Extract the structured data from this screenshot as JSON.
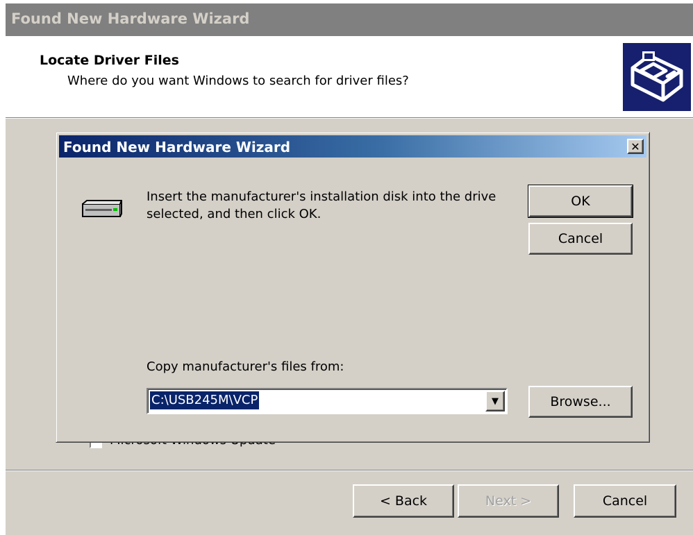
{
  "background_wizard": {
    "title": "Found New Hardware Wizard",
    "header": {
      "title": "Locate Driver Files",
      "subtitle": "Where do you want Windows to search for driver files?"
    },
    "checkbox_label": "Microsoft Windows Update",
    "buttons": {
      "back": "< Back",
      "next": "Next >",
      "cancel": "Cancel"
    }
  },
  "dialog": {
    "title": "Found New Hardware Wizard",
    "close_glyph": "✕",
    "message": "Insert the manufacturer's installation disk into the drive selected, and then click OK.",
    "ok_label": "OK",
    "cancel_label": "Cancel",
    "copy_label": "Copy manufacturer's files from:",
    "path_value": "C:\\USB245M\\VCP",
    "dropdown_glyph": "▼",
    "browse_label": "Browse..."
  },
  "icons": {
    "wizard_header": "hardware-install-icon",
    "drive": "floppy-drive-icon"
  },
  "colors": {
    "title_active_start": "#0a246a",
    "title_active_end": "#a6caf0",
    "title_inactive": "#808080",
    "face": "#d4d0c8",
    "selection": "#0a246a"
  }
}
